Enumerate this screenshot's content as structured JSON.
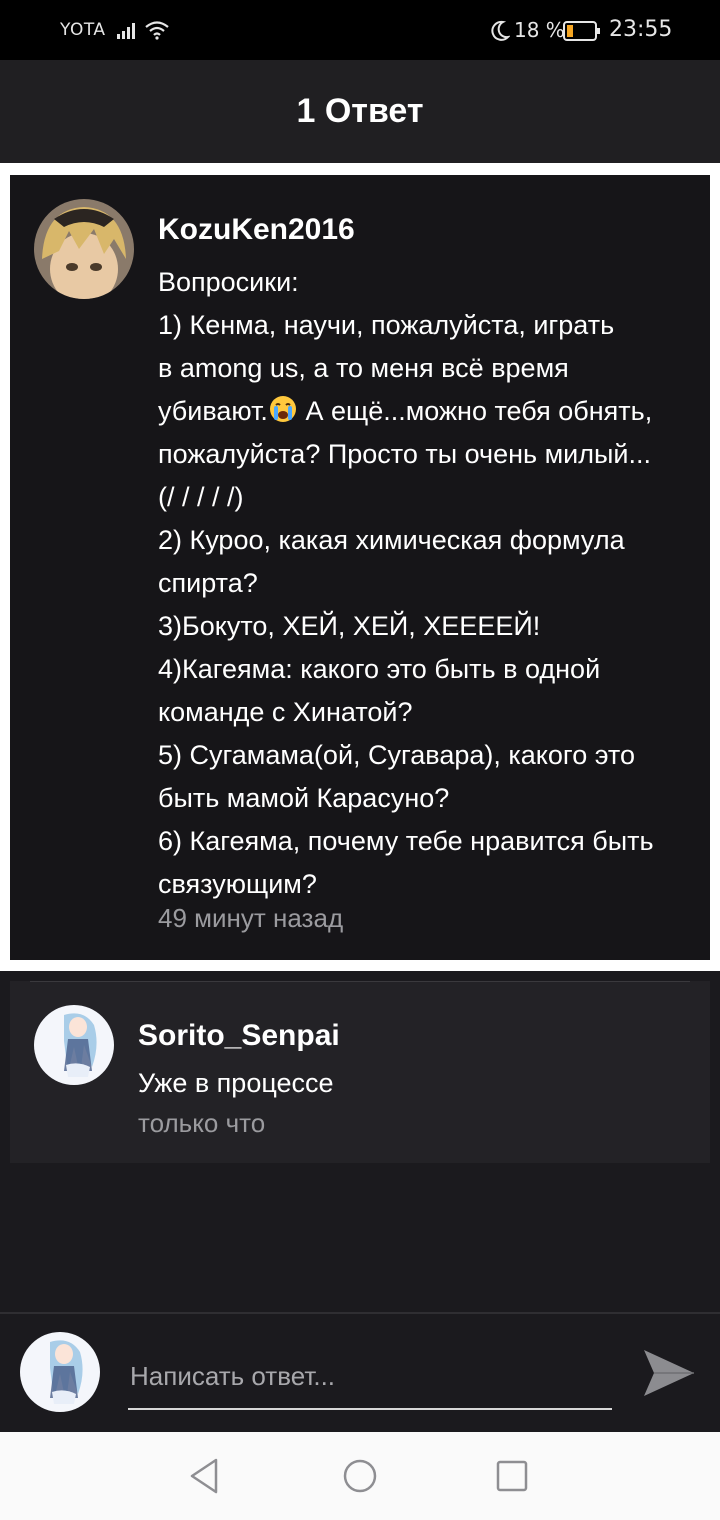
{
  "status_bar": {
    "carrier": "YOTA",
    "battery_percent": "18 %",
    "time": "23:55",
    "icons": [
      "signal-icon",
      "wifi-icon",
      "moon-icon",
      "battery-icon"
    ]
  },
  "header": {
    "title": "1 Ответ"
  },
  "main_comment": {
    "username": "KozuKen2016",
    "lines": [
      "Вопросики:",
      "1) Кенма, научи, пожалуйста, играть",
      "в among us, а то меня всё время",
      "убивают.",
      " А ещё...можно тебя обнять,",
      "пожалуйста? Просто ты очень милый...",
      "(/ / / / /)",
      "2) Куроо, какая химическая формула",
      "спирта?",
      "3)Бокуто, ХЕЙ, ХЕЙ, ХЕЕЕЕЙ!",
      "4)Кагеяма: какого это быть в одной",
      "команде с Хинатой?",
      "5) Сугамама(ой, Сугавара), какого это",
      "быть мамой Карасуно?",
      "6) Кагеяма, почему тебе нравится быть",
      "связующим?"
    ],
    "time": "49 минут назад"
  },
  "reply": {
    "username": "Sorito_Senpai",
    "text": "Уже в процессе",
    "time": "только что"
  },
  "composer": {
    "placeholder": "Написать ответ..."
  },
  "colors": {
    "background": "#1b1a1e",
    "header": "#201f22",
    "highlight_border": "#ffffff",
    "secondary_text": "#9b9b9f"
  }
}
